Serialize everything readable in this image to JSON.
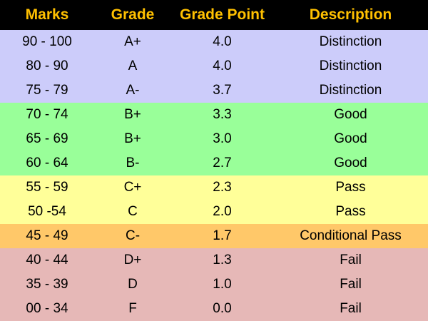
{
  "headers": [
    "Marks",
    "Grade",
    "Grade Point",
    "Description"
  ],
  "band_colors": {
    "distinction": "#ccccfa",
    "good": "#99ff99",
    "pass": "#ffff99",
    "conditional_pass": "#ffc869",
    "fail": "#e6b8b7"
  },
  "header_colors": {
    "background": "#000000",
    "text": "#ffc000"
  },
  "rows": [
    {
      "marks": "90 - 100",
      "grade": "A+",
      "grade_point": "4.0",
      "description": "Distinction",
      "band": "distinction"
    },
    {
      "marks": "80 - 90",
      "grade": "A",
      "grade_point": "4.0",
      "description": "Distinction",
      "band": "distinction"
    },
    {
      "marks": "75 - 79",
      "grade": "A-",
      "grade_point": "3.7",
      "description": "Distinction",
      "band": "distinction"
    },
    {
      "marks": "70 - 74",
      "grade": "B+",
      "grade_point": "3.3",
      "description": "Good",
      "band": "good"
    },
    {
      "marks": "65 - 69",
      "grade": "B+",
      "grade_point": "3.0",
      "description": "Good",
      "band": "good"
    },
    {
      "marks": "60 - 64",
      "grade": "B-",
      "grade_point": "2.7",
      "description": "Good",
      "band": "good"
    },
    {
      "marks": "55 - 59",
      "grade": "C+",
      "grade_point": "2.3",
      "description": "Pass",
      "band": "pass"
    },
    {
      "marks": "50 -54",
      "grade": "C",
      "grade_point": "2.0",
      "description": "Pass",
      "band": "pass"
    },
    {
      "marks": "45 - 49",
      "grade": "C-",
      "grade_point": "1.7",
      "description": "Conditional Pass",
      "band": "conditional_pass"
    },
    {
      "marks": "40 - 44",
      "grade": "D+",
      "grade_point": "1.3",
      "description": "Fail",
      "band": "fail"
    },
    {
      "marks": "35 - 39",
      "grade": "D",
      "grade_point": "1.0",
      "description": "Fail",
      "band": "fail"
    },
    {
      "marks": "00 - 34",
      "grade": "F",
      "grade_point": "0.0",
      "description": "Fail",
      "band": "fail"
    }
  ]
}
